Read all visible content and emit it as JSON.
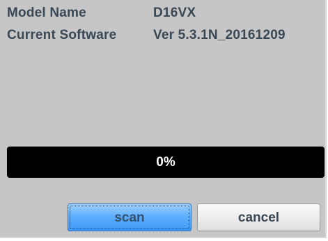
{
  "device_info": {
    "model_name_label": "Model Name",
    "model_name_value": "D16VX",
    "software_label": "Current Software",
    "software_value": "Ver 5.3.1N_20161209"
  },
  "progress": {
    "value": 0,
    "text": "0%"
  },
  "buttons": {
    "scan_label": "scan",
    "cancel_label": "cancel"
  },
  "colors": {
    "panel_background": "#c6c6c6",
    "label_text": "#3a4754",
    "progress_track": "#000000",
    "progress_text": "#ffffff",
    "scan_button": "#5eafff",
    "cancel_button": "#ececec"
  }
}
